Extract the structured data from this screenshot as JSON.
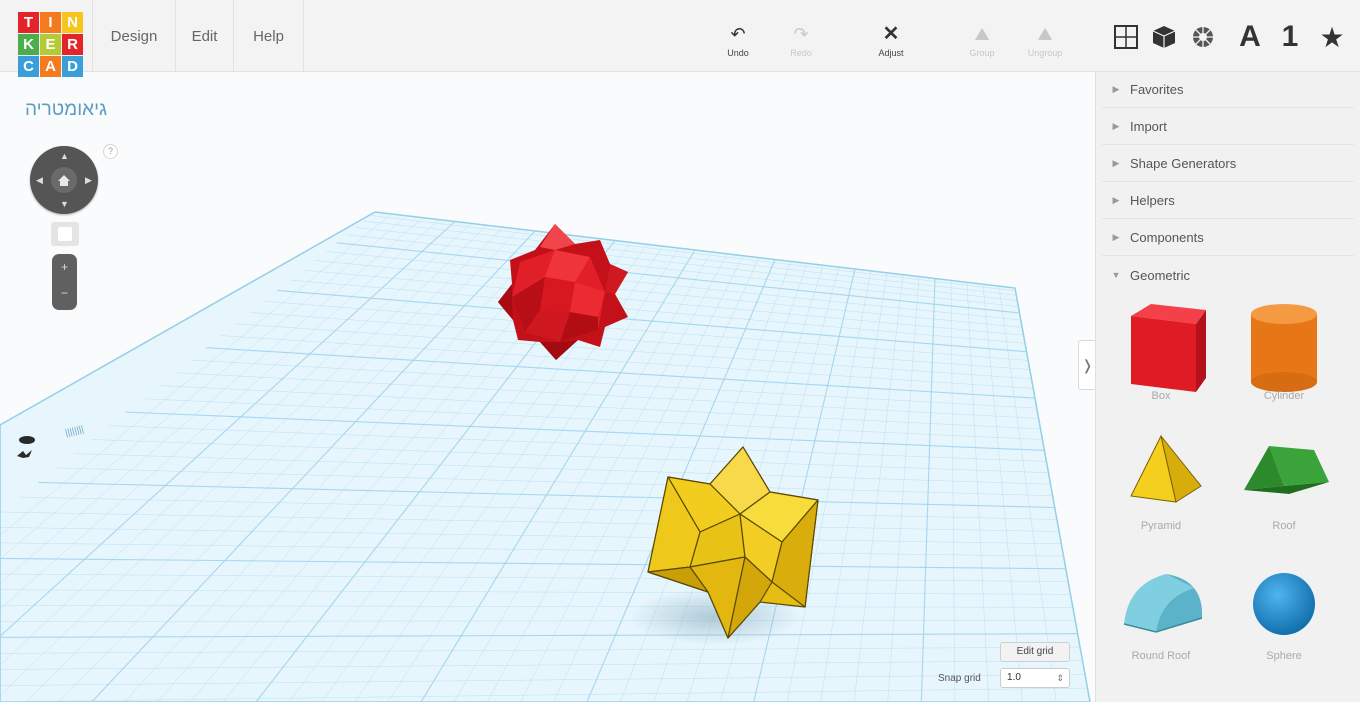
{
  "app": {
    "logo_letters": [
      "T",
      "I",
      "N",
      "K",
      "E",
      "R",
      "C",
      "A",
      "D"
    ],
    "logo_colors": [
      "#e3242b",
      "#f47a20",
      "#f8c51c",
      "#4bad4b",
      "#b6c936",
      "#e3242b",
      "#3a9fd8",
      "#f47a20",
      "#3a9fd8"
    ]
  },
  "menu": {
    "items": [
      "Design",
      "Edit",
      "Help"
    ]
  },
  "toolbar": {
    "undo": "Undo",
    "redo": "Redo",
    "adjust": "Adjust",
    "group": "Group",
    "ungroup": "Ungroup"
  },
  "view_icons": {
    "letter_a": "A",
    "number_one": "1"
  },
  "document": {
    "title": "גיאומטריה"
  },
  "nav": {
    "help": "?",
    "zoom_in": "+",
    "zoom_out": "−"
  },
  "panel": {
    "sections": [
      "Favorites",
      "Import",
      "Shape Generators",
      "Helpers",
      "Components",
      "Geometric"
    ],
    "shapes": [
      "Box",
      "Cylinder",
      "Pyramid",
      "Roof",
      "Round Roof",
      "Sphere"
    ]
  },
  "grid": {
    "edit_label": "Edit grid",
    "snap_label": "Snap grid",
    "snap_value": "1.0",
    "snap_chevron": "⇕"
  },
  "colors": {
    "accent": "#5b9cc4",
    "grid_line": "#9fd4ec",
    "red_shape": "#e11f28",
    "yellow_shape": "#f2cd1e"
  }
}
